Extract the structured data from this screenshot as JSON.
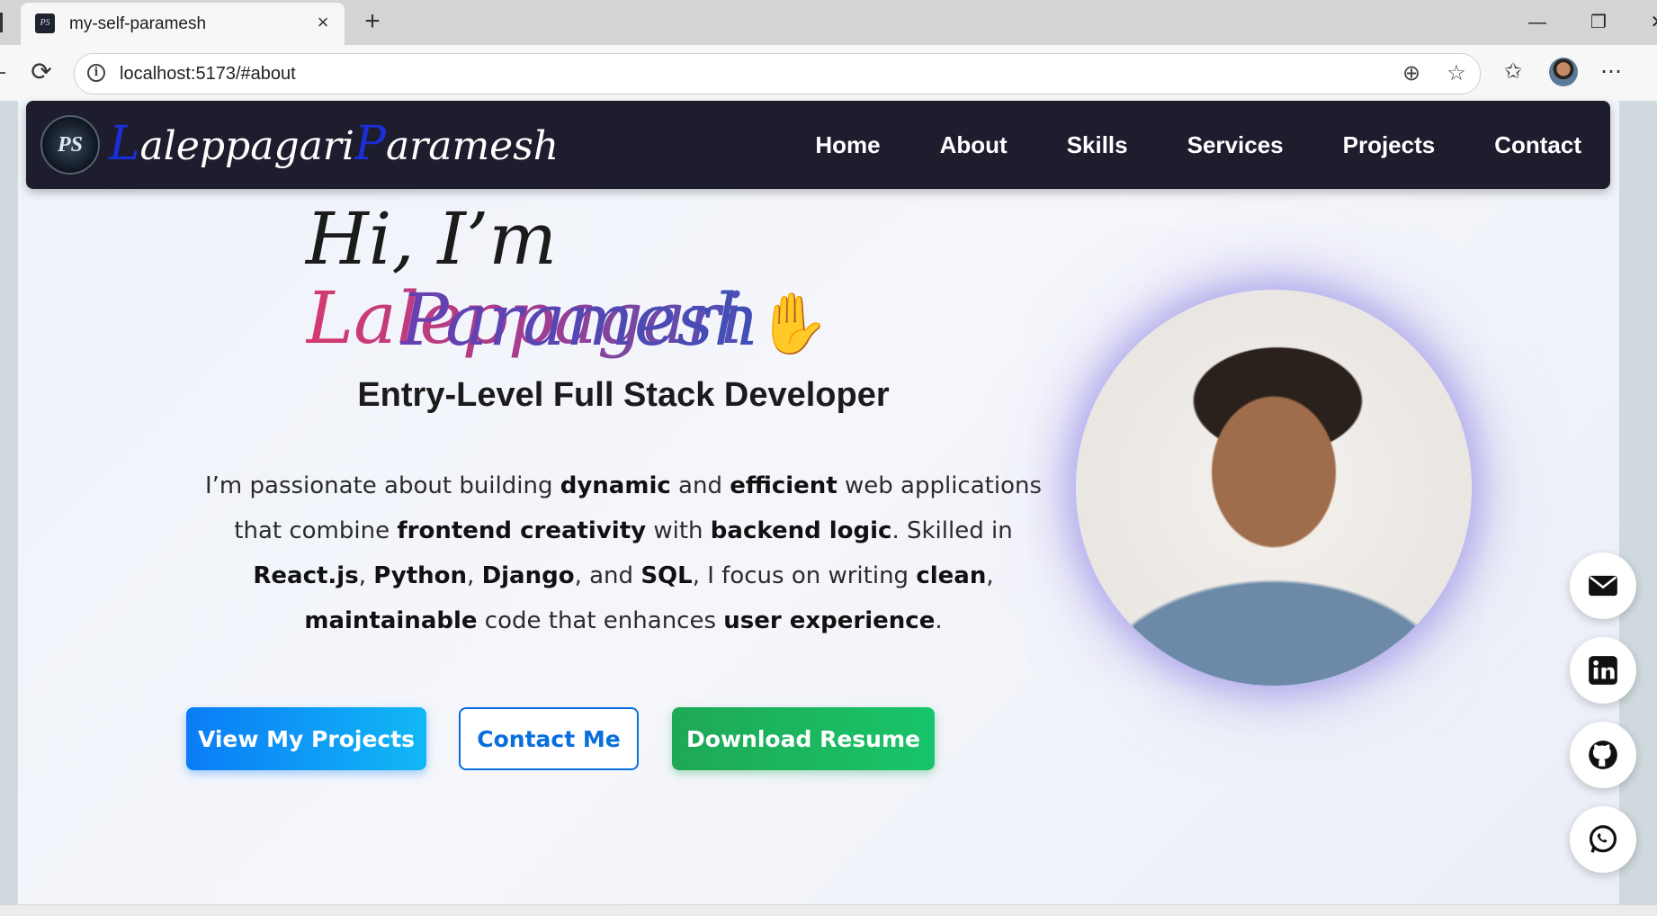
{
  "browser": {
    "tab_title": "my-self-paramesh",
    "url": "localhost:5173/#about"
  },
  "nav": {
    "brand": {
      "initial_first": "L",
      "rest_first": "aleppagari",
      "initial_last": "P",
      "rest_last": "aramesh",
      "badge_text": "PS"
    },
    "links": [
      "Home",
      "About",
      "Skills",
      "Services",
      "Projects",
      "Contact"
    ]
  },
  "hero": {
    "greeting_prefix": "Hi, I’m ",
    "first_name": "Laleppagari",
    "last_name": "Paramesh",
    "role": "Entry-Level Full Stack Developer",
    "buttons": {
      "projects": "View My Projects",
      "contact": "Contact Me",
      "resume": "Download Resume"
    }
  },
  "social": [
    "email-icon",
    "linkedin-icon",
    "github-icon",
    "whatsapp-icon"
  ],
  "colors": {
    "nav_bg": "#1d1d2e",
    "brand_initial": "#1a2fd8",
    "primary_button": "#0a7cf7",
    "resume_button": "#1fa855"
  }
}
